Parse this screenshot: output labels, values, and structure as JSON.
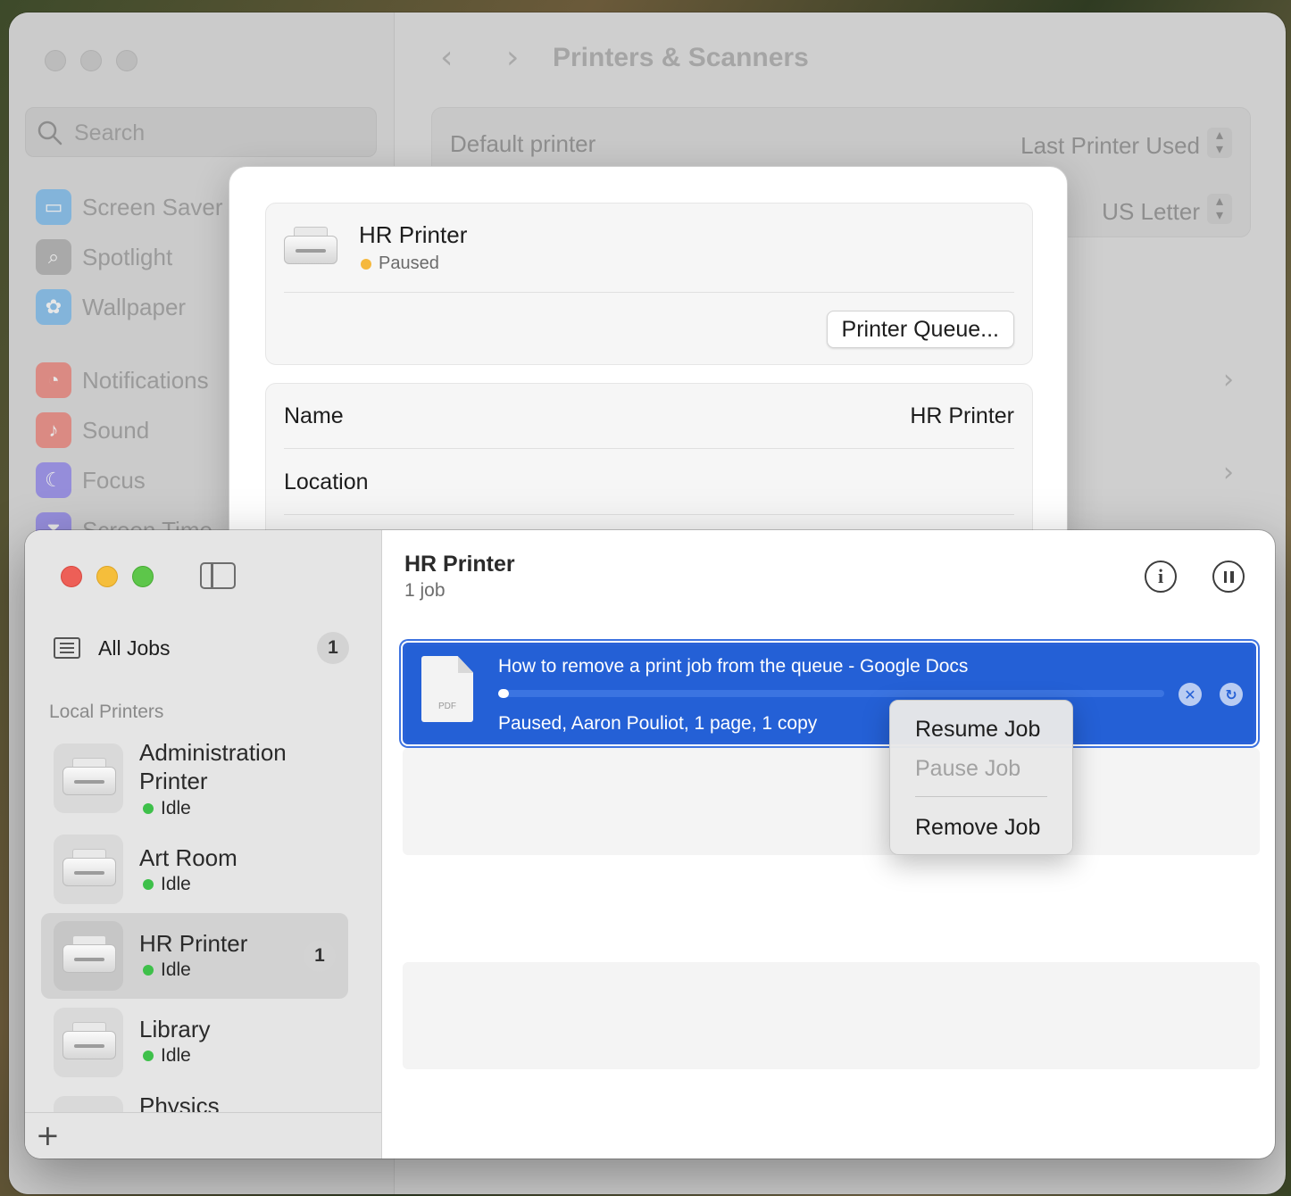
{
  "settings": {
    "title": "Printers & Scanners",
    "search_placeholder": "Search",
    "sidebar_items": [
      {
        "label": "Screen Saver",
        "icon": "screen-saver-icon",
        "color": "#4aa3e8"
      },
      {
        "label": "Spotlight",
        "icon": "spotlight-icon",
        "color": "#8e8e8e"
      },
      {
        "label": "Wallpaper",
        "icon": "wallpaper-icon",
        "color": "#4aa3e8"
      },
      {
        "label": "Notifications",
        "icon": "notifications-icon",
        "color": "#e8554a"
      },
      {
        "label": "Sound",
        "icon": "sound-icon",
        "color": "#e8554a"
      },
      {
        "label": "Focus",
        "icon": "focus-icon",
        "color": "#6a5ce8"
      },
      {
        "label": "Screen Time",
        "icon": "screen-time-icon",
        "color": "#6a5ce8"
      }
    ],
    "default_printer_label": "Default printer",
    "default_printer_value": "Last Printer Used",
    "paper_size_value": "US Letter"
  },
  "sheet": {
    "printer_name": "HR Printer",
    "status": "Paused",
    "queue_button": "Printer Queue...",
    "name_label": "Name",
    "name_value": "HR Printer",
    "location_label": "Location"
  },
  "queue": {
    "sidebar": {
      "all_jobs_label": "All Jobs",
      "all_jobs_count": "1",
      "section_label": "Local Printers",
      "printers": [
        {
          "name": "Administration Printer",
          "status": "Idle",
          "count": ""
        },
        {
          "name": "Art Room",
          "status": "Idle",
          "count": ""
        },
        {
          "name": "HR Printer",
          "status": "Idle",
          "count": "1"
        },
        {
          "name": "Library",
          "status": "Idle",
          "count": ""
        },
        {
          "name": "Physics",
          "status": "",
          "count": ""
        }
      ],
      "add_label": "+"
    },
    "title": "HR Printer",
    "subtitle": "1 job",
    "job": {
      "title": "How to remove a print job from the queue - Google Docs",
      "details": "Paused, Aaron Pouliot, 1 page, 1 copy",
      "file_type": "PDF",
      "progress": 0.01
    }
  },
  "context_menu": {
    "items": [
      {
        "label": "Resume Job",
        "enabled": true
      },
      {
        "label": "Pause Job",
        "enabled": false
      },
      {
        "label": "Remove Job",
        "enabled": true
      }
    ]
  }
}
